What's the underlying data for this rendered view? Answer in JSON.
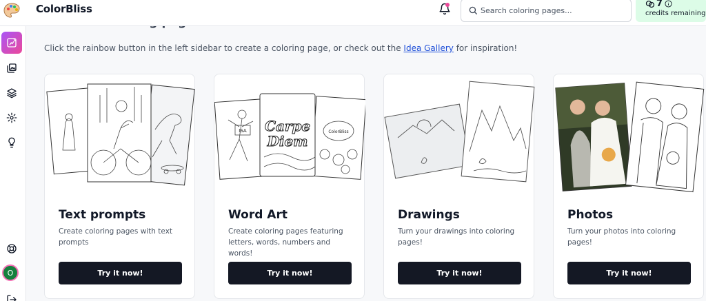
{
  "app": {
    "title": "ColorBliss"
  },
  "search": {
    "placeholder": "Search coloring pages..."
  },
  "credits": {
    "count": "7",
    "label": "credits remaining"
  },
  "sidebar": {
    "items": [
      "create-icon",
      "gallery-icon",
      "layers-icon",
      "settings-icon",
      "idea-icon"
    ],
    "bottom": [
      "help-icon",
      "avatar",
      "logout-icon"
    ],
    "avatar_initial": "O"
  },
  "main": {
    "heading": "Create a coloring page",
    "intro_before": "Click the rainbow button in the left sidebar to create a coloring page, or check out the ",
    "intro_link": "Idea Gallery",
    "intro_after": " for inspiration!",
    "cards": [
      {
        "title": "Text prompts",
        "description": "Create coloring pages with text prompts",
        "button": "Try it now!"
      },
      {
        "title": "Word Art",
        "description": "Create coloring pages featuring letters, words, numbers and words!",
        "button": "Try it now!"
      },
      {
        "title": "Drawings",
        "description": "Turn your drawings into coloring pages!",
        "button": "Try it now!"
      },
      {
        "title": "Photos",
        "description": "Turn your photos into coloring pages!",
        "button": "Try it now!"
      }
    ],
    "art_text": {
      "word_art_1": "Carpe",
      "word_art_2": "Diem",
      "shirt": "ISA",
      "shell": "ColorBliss"
    }
  },
  "colors": {
    "accent_button": "#141824",
    "credits_bg": "#dcfce7",
    "notification_dot": "#ec4899",
    "link": "#1d4ed8"
  }
}
